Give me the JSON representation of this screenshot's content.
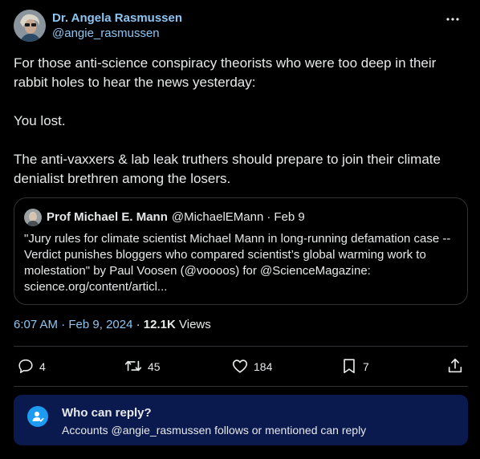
{
  "author": {
    "display_name": "Dr. Angela Rasmussen",
    "handle": "@angie_rasmussen"
  },
  "tweet": {
    "paragraphs": [
      "For those anti-science conspiracy theorists who were too deep in their rabbit holes to hear the news yesterday:",
      "You lost.",
      "The anti-vaxxers & lab leak truthers should prepare to join their climate denialist brethren among the losers."
    ]
  },
  "quoted_tweet": {
    "display_name": "Prof Michael E. Mann",
    "handle": "@MichaelEMann",
    "separator": "·",
    "date": "Feb 9",
    "text": "\"Jury rules for climate scientist Michael Mann in long-running defamation case -- Verdict punishes bloggers who compared scientist’s global warming work to molestation\" by Paul Voosen (@voooos) for @ScienceMagazine: science.org/content/articl..."
  },
  "meta": {
    "time": "6:07 AM",
    "separator1": "·",
    "date": "Feb 9, 2024",
    "separator2": "·",
    "views_count": "12.1K",
    "views_label": "Views"
  },
  "actions": {
    "replies": "4",
    "reposts": "45",
    "likes": "184",
    "bookmarks": "7"
  },
  "icons": [
    "more-icon",
    "reply-icon",
    "repost-icon",
    "like-icon",
    "bookmark-icon",
    "share-icon",
    "user-icon"
  ],
  "reply_restriction": {
    "title": "Who can reply?",
    "description": "Accounts @angie_rasmussen follows or mentioned can reply"
  },
  "colors": {
    "background": "#000000",
    "link": "#8ec5f2",
    "accent": "#1d9bf0",
    "reply_box": "#0a1a4e"
  }
}
